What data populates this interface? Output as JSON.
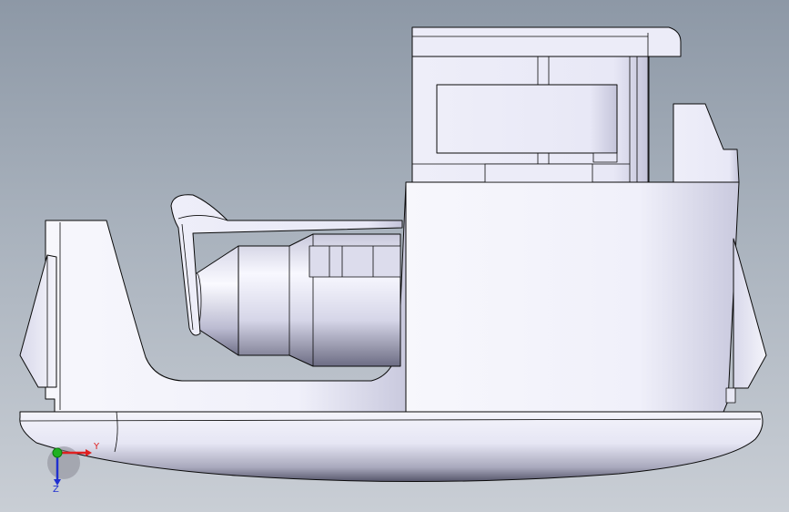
{
  "view": {
    "background_top": "#8d98a6",
    "background_bottom": "#c9ced5",
    "part_fill": "#ebebf8",
    "edge_color": "#0a0a0a"
  },
  "triad": {
    "x_label": "Y",
    "z_label": "Z",
    "x_color": "#e02020",
    "y_color": "#20b020",
    "z_color": "#2030d0"
  }
}
